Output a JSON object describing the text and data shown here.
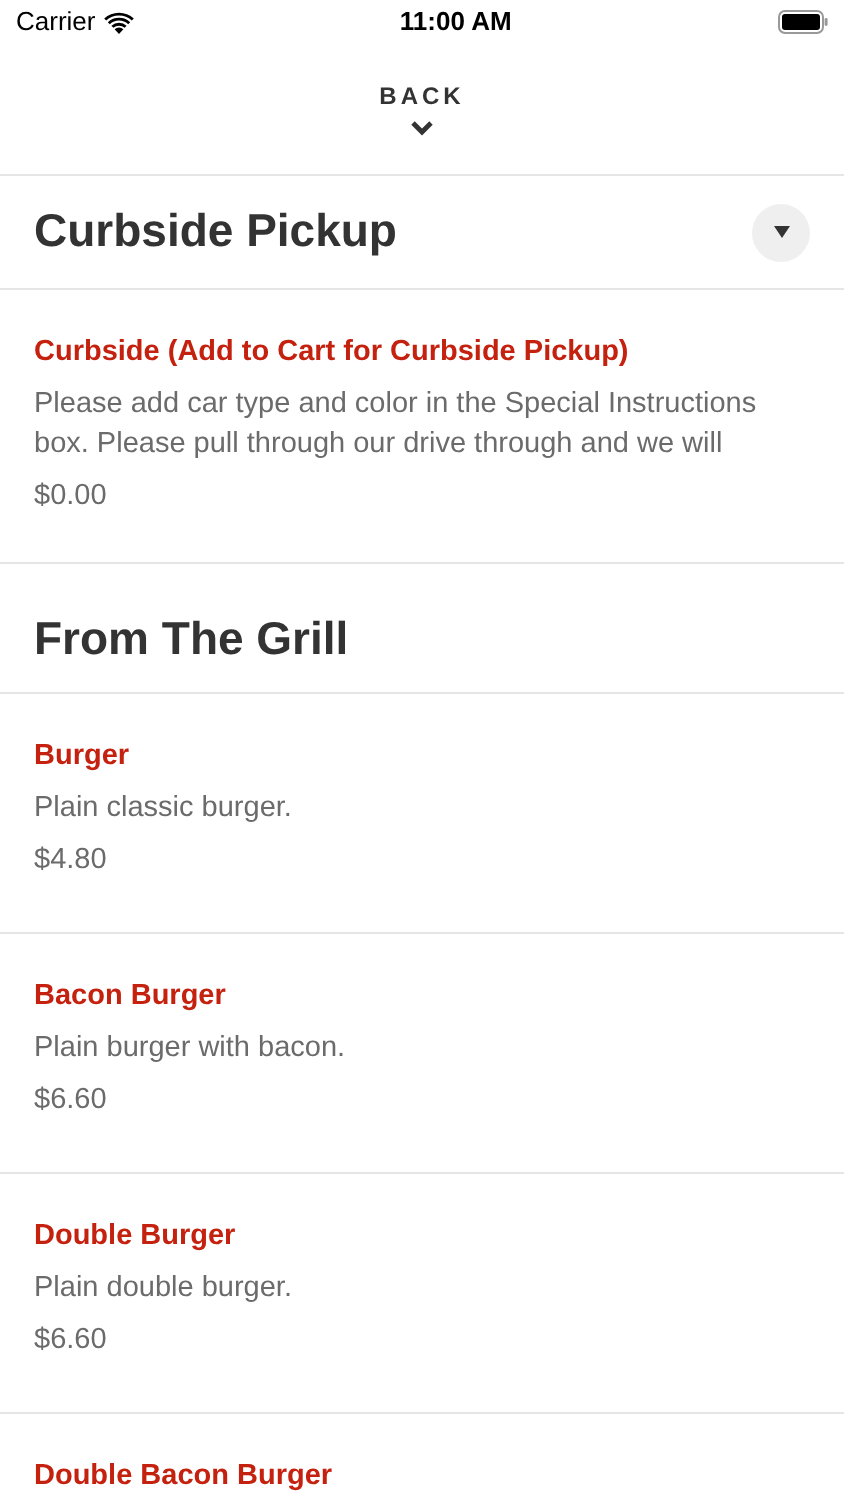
{
  "status_bar": {
    "carrier": "Carrier",
    "time": "11:00 AM"
  },
  "back": {
    "label": "BACK"
  },
  "sections": [
    {
      "title": "Curbside Pickup",
      "has_toggle": true,
      "items": [
        {
          "name": "Curbside (Add to Cart for Curbside Pickup)",
          "description": "Please add car type and color in the Special Instructions box. Please pull through our drive through and we will",
          "price": "$0.00"
        }
      ]
    },
    {
      "title": "From The Grill",
      "has_toggle": false,
      "items": [
        {
          "name": "Burger",
          "description": "Plain classic burger.",
          "price": "$4.80"
        },
        {
          "name": "Bacon Burger",
          "description": "Plain burger with bacon.",
          "price": "$6.60"
        },
        {
          "name": "Double Burger",
          "description": "Plain double burger.",
          "price": "$6.60"
        },
        {
          "name": "Double Bacon Burger"
        }
      ]
    }
  ]
}
